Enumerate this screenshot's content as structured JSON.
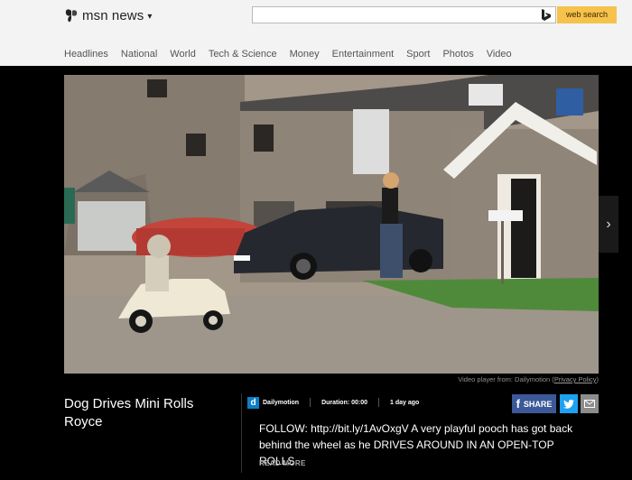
{
  "header": {
    "logo_text": "msn news",
    "search_placeholder": "",
    "search_button": "web search",
    "nav": [
      "Headlines",
      "National",
      "World",
      "Tech & Science",
      "Money",
      "Entertainment",
      "Sport",
      "Photos",
      "Video"
    ]
  },
  "video": {
    "attribution_prefix": "Video player from: Dailymotion (",
    "attribution_link": "Privacy Policy",
    "attribution_suffix": ")",
    "watermark": "dailymotion"
  },
  "article": {
    "title": "Dog Drives Mini Rolls Royce",
    "source": "Dailymotion",
    "duration": "Duration: 00:00",
    "age": "1 day ago",
    "description": "FOLLOW: http://bit.ly/1AvOxgV A very playful pooch has got back behind the wheel as he DRIVES AROUND IN AN OPEN-TOP ROLLS",
    "read_more": "READ MORE"
  },
  "share": {
    "facebook_label": "SHARE"
  },
  "colors": {
    "accent_search": "#f6c24b",
    "facebook": "#3b5998",
    "twitter": "#1da1f2",
    "dailymotion": "#0b7ec7"
  }
}
